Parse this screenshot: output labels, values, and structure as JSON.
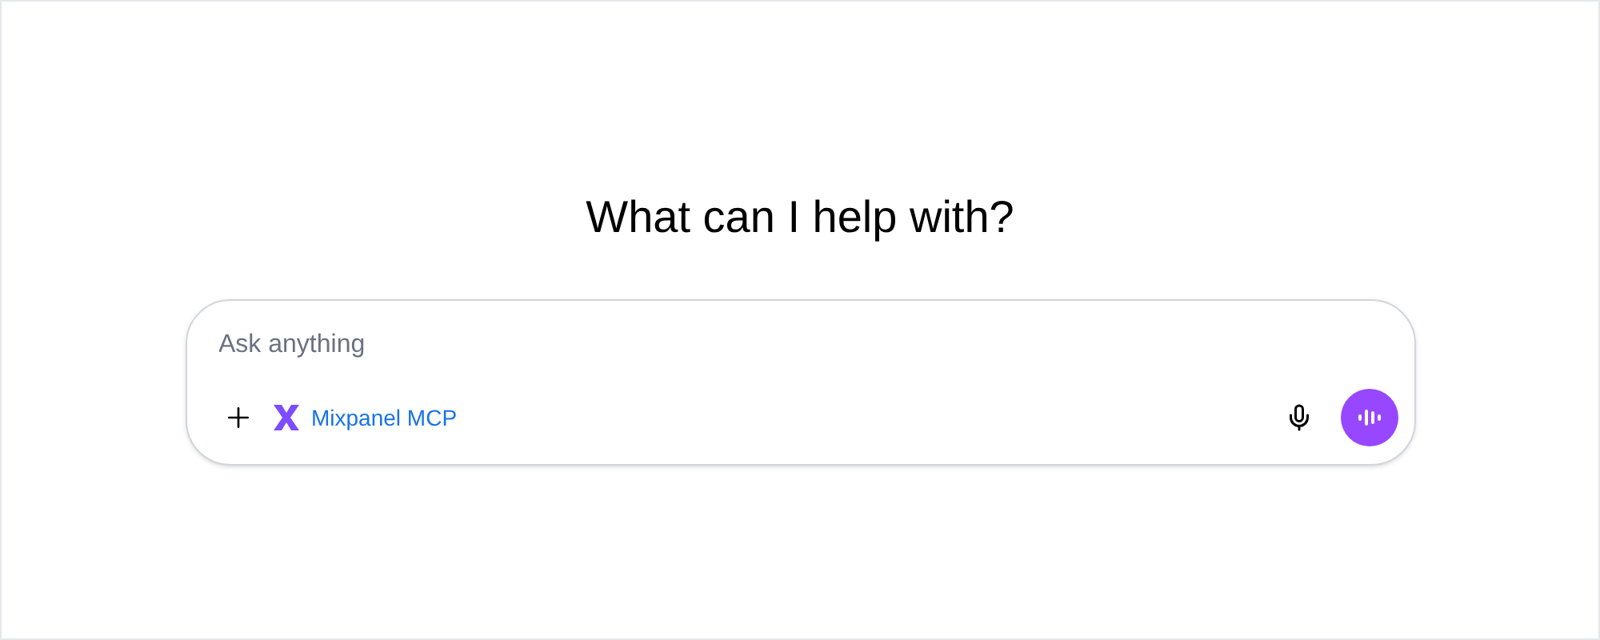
{
  "heading": "What can I help with?",
  "composer": {
    "placeholder": "Ask anything",
    "tool": {
      "label": "Mixpanel MCP"
    }
  }
}
